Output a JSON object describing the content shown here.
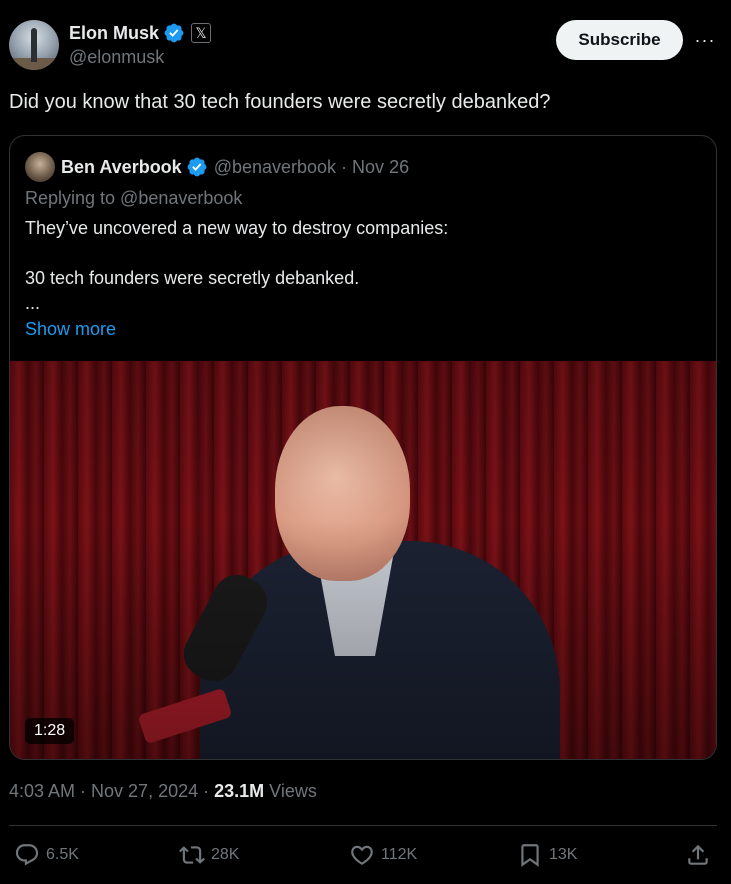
{
  "author": {
    "name": "Elon Musk",
    "handle": "@elonmusk",
    "affiliation_badge": "𝕏"
  },
  "header": {
    "subscribe_label": "Subscribe",
    "more_label": "···"
  },
  "tweet": {
    "text": "Did you know that 30 tech founders were secretly debanked?"
  },
  "quote": {
    "name": "Ben Averbook",
    "handle_date": "@benaverbook · Nov 26",
    "replying_to": "Replying to @benaverbook",
    "line1": "They’ve uncovered a new way to destroy companies:",
    "line2": "30 tech founders were secretly debanked.",
    "ellipsis": "...",
    "show_more": "Show more",
    "video_duration": "1:28"
  },
  "meta": {
    "time_date": "4:03 AM · Nov 27, 2024 · ",
    "views_count": "23.1M",
    "views_label": " Views"
  },
  "actions": {
    "replies": "6.5K",
    "reposts": "28K",
    "likes": "112K",
    "bookmarks": "13K"
  },
  "colors": {
    "background": "#000000",
    "text_primary": "#e7e9ea",
    "text_secondary": "#71767b",
    "accent_blue": "#1d9bf0",
    "verified_blue": "#1d9bf0",
    "border": "#2f3336"
  },
  "icons": [
    "verified-badge-icon",
    "x-affiliation-icon",
    "more-icon",
    "reply-icon",
    "repost-icon",
    "like-icon",
    "bookmark-icon",
    "share-icon"
  ]
}
